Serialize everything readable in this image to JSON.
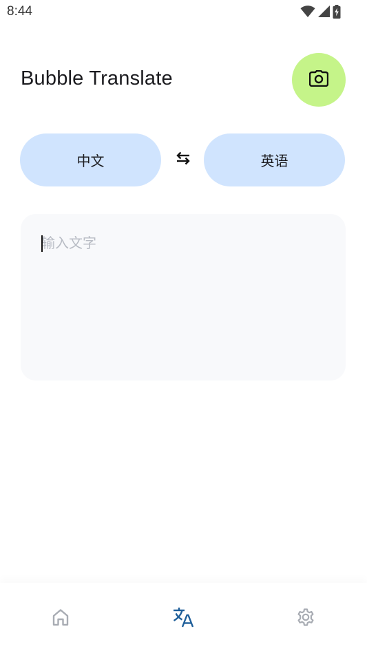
{
  "status_bar": {
    "time": "8:44",
    "icons": [
      "wifi-icon",
      "cell-signal-icon",
      "battery-charging-icon"
    ]
  },
  "header": {
    "title": "Bubble Translate",
    "camera_button_icon": "camera-icon"
  },
  "languages": {
    "source": "中文",
    "target": "英语",
    "swap_icon": "swap-arrows-icon"
  },
  "input": {
    "placeholder": "输入文字",
    "value": ""
  },
  "bottom_nav": {
    "items": [
      {
        "icon": "home-icon",
        "active": false
      },
      {
        "icon": "translate-icon",
        "active": true
      },
      {
        "icon": "settings-gear-icon",
        "active": false
      }
    ]
  },
  "colors": {
    "camera_fab": "#c5f489",
    "language_pill": "#d0e4fe",
    "input_card": "#f8f9fb",
    "nav_active": "#1f5f9a",
    "nav_inactive": "#a8acb3"
  }
}
